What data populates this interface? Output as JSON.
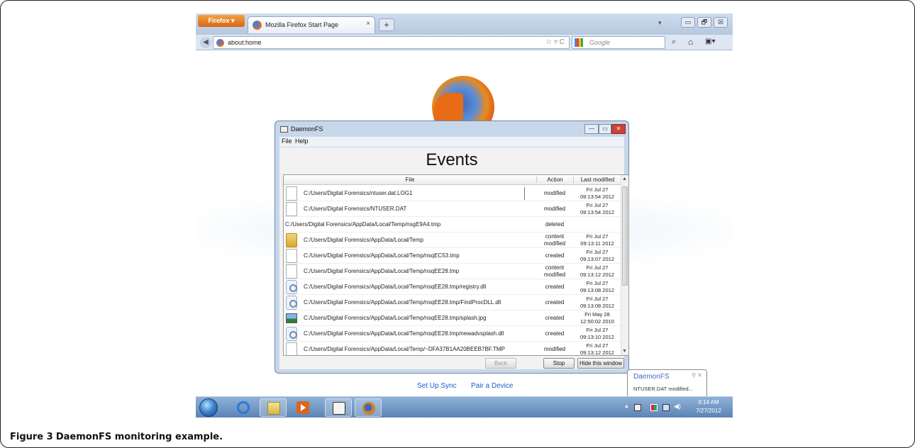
{
  "firefox": {
    "menu_button": "Firefox ▾",
    "tab_title": "Mozilla Firefox Start Page",
    "tab_close": "×",
    "new_tab": "+",
    "list_all_tabs": "▾",
    "window_buttons": [
      "▭",
      "🗗",
      "☒"
    ],
    "back": "◀",
    "url": "about:home",
    "url_icons": "☆ ▿ C",
    "search_placeholder": "Google",
    "search_go": "⌕",
    "home": "⌂",
    "bookmarks": "▣▾"
  },
  "start_page": {
    "set_up_sync": "Set Up Sync",
    "pair_a_device": "Pair a Device"
  },
  "daemonfs": {
    "window_title": "DaemonFS",
    "window_buttons": [
      "—",
      "▭",
      "✕"
    ],
    "menu": [
      "File",
      "Help"
    ],
    "heading": "Events",
    "columns": [
      "File",
      "Action",
      "Last modified"
    ],
    "rows": [
      {
        "icon": "document-icon",
        "file": "C:/Users/Digital Forensics/ntuser.dat.LOG1",
        "action": "modified",
        "last_modified_1": "Fri Jul 27",
        "last_modified_2": "09:13:54 2012"
      },
      {
        "icon": "document-icon",
        "file": "C:/Users/Digital Forensics/NTUSER.DAT",
        "action": "modified",
        "last_modified_1": "Fri Jul 27",
        "last_modified_2": "09:13:54 2012"
      },
      {
        "icon": "",
        "file": "C:/Users/Digital Forensics/AppData/Local/Temp/nsgE9A4.tmp",
        "action": "deleted",
        "last_modified_1": "",
        "last_modified_2": ""
      },
      {
        "icon": "folder-icon",
        "file": "C:/Users/Digital Forensics/AppData/Local/Temp",
        "action_1": "content",
        "action_2": "modified",
        "last_modified_1": "Fri Jul 27",
        "last_modified_2": "09:13:11 2012"
      },
      {
        "icon": "document-icon",
        "file": "C:/Users/Digital Forensics/AppData/Local/Temp/nsqEC53.tmp",
        "action": "created",
        "last_modified_1": "Fri Jul 27",
        "last_modified_2": "09:13:07 2012"
      },
      {
        "icon": "document-icon",
        "file": "C:/Users/Digital Forensics/AppData/Local/Temp/nsqEE28.tmp",
        "action_1": "content",
        "action_2": "modified",
        "last_modified_1": "Fri Jul 27",
        "last_modified_2": "09:13:12 2012"
      },
      {
        "icon": "dll-icon",
        "file": "C:/Users/Digital Forensics/AppData/Local/Temp/nsqEE28.tmp/registry.dll",
        "action": "created",
        "last_modified_1": "Fri Jul 27",
        "last_modified_2": "09:13:08 2012"
      },
      {
        "icon": "dll-icon",
        "file": "C:/Users/Digital Forensics/AppData/Local/Temp/nsqEE28.tmp/FindProcDLL.dll",
        "action": "created",
        "last_modified_1": "Fri Jul 27",
        "last_modified_2": "09:13:08 2012"
      },
      {
        "icon": "image-icon",
        "file": "C:/Users/Digital Forensics/AppData/Local/Temp/nsqEE28.tmp/splash.jpg",
        "action": "created",
        "last_modified_1": "Fri May 28",
        "last_modified_2": "12:50:02 2010"
      },
      {
        "icon": "dll-icon",
        "file": "C:/Users/Digital Forensics/AppData/Local/Temp/nsqEE28.tmp/newadvsplash.dll",
        "action": "created",
        "last_modified_1": "Fri Jul 27",
        "last_modified_2": "09:13:10 2012"
      },
      {
        "icon": "document-icon",
        "file": "C:/Users/Digital Forensics/AppData/Local/Temp/~DFA37B1AA20BEEB7BF.TMP",
        "action": "modified",
        "last_modified_1": "Fri Jul 27",
        "last_modified_2": "09:13:12 2012"
      }
    ],
    "scroll_up": "▲",
    "scroll_down": "▼",
    "buttons": {
      "back": "Back",
      "stop": "Stop",
      "hide": "Hide this window"
    }
  },
  "notification": {
    "title": "DaemonFS",
    "controls": "⚲ ✕",
    "text": "NTUSER.DAT modified..."
  },
  "taskbar": {
    "tray_arrow": "▲",
    "volume": "◀)",
    "time": "9:14 AM",
    "date": "7/27/2012"
  },
  "caption": {
    "label": "Figure 3",
    "text": "DaemonFS monitoring example."
  }
}
